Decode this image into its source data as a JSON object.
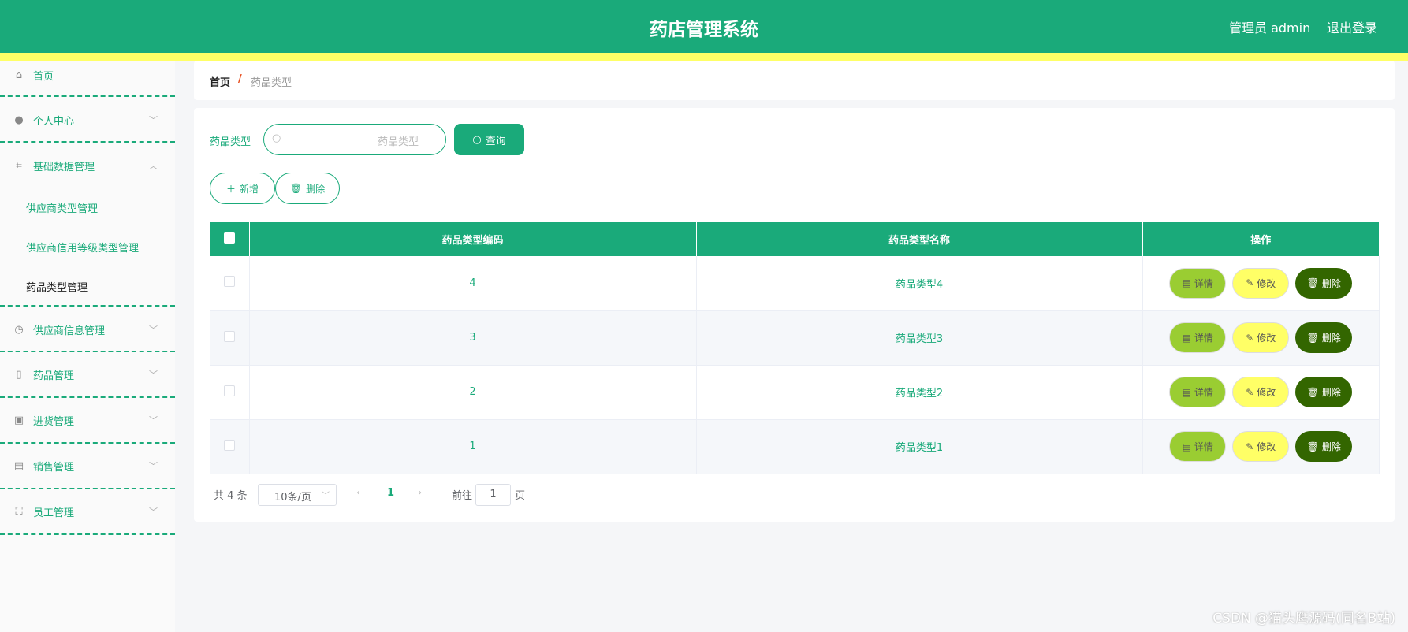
{
  "header": {
    "title": "药店管理系统",
    "user": "管理员 admin",
    "logout": "退出登录"
  },
  "sidebar": {
    "items": [
      {
        "label": "首页",
        "icon": "home-icon"
      },
      {
        "label": "个人中心",
        "icon": "user-icon"
      },
      {
        "label": "基础数据管理",
        "icon": "crop-icon"
      },
      {
        "label": "供应商信息管理",
        "icon": "compass-icon"
      },
      {
        "label": "药品管理",
        "icon": "microphone-icon"
      },
      {
        "label": "进货管理",
        "icon": "clipboard-icon"
      },
      {
        "label": "销售管理",
        "icon": "chat-icon"
      },
      {
        "label": "员工管理",
        "icon": "fullscreen-icon"
      }
    ],
    "subitems": [
      "供应商类型管理",
      "供应商信用等级类型管理",
      "药品类型管理"
    ]
  },
  "breadcrumb": {
    "home": "首页",
    "sep": "/",
    "current": "药品类型"
  },
  "search": {
    "label": "药品类型",
    "placeholder": "药品类型",
    "query": "查询"
  },
  "toolbar": {
    "add": "新增",
    "delete": "删除"
  },
  "table": {
    "headers": [
      "药品类型编码",
      "药品类型名称",
      "操作"
    ],
    "rows": [
      {
        "code": "4",
        "name": "药品类型4"
      },
      {
        "code": "3",
        "name": "药品类型3"
      },
      {
        "code": "2",
        "name": "药品类型2"
      },
      {
        "code": "1",
        "name": "药品类型1"
      }
    ],
    "actions": {
      "detail": "详情",
      "edit": "修改",
      "delete": "删除"
    }
  },
  "pagination": {
    "total": "共 4 条",
    "size": "10条/页",
    "page": "1",
    "goto": "前往",
    "goto_value": "1",
    "page_unit": "页"
  },
  "watermark": "CSDN @猫头鹰源码(同名B站)",
  "colors": {
    "primary": "#1aaa7a",
    "accent": "#ffff66",
    "detail": "#9acd32",
    "edit": "#ffff66",
    "delete": "#336600"
  }
}
